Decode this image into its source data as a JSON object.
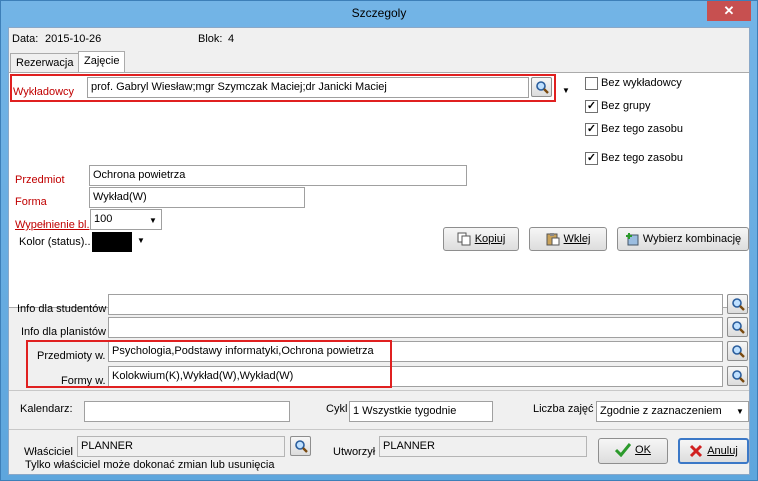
{
  "window": {
    "title": "Szczegoly",
    "close_glyph": "✕"
  },
  "header": {
    "data_label": "Data:",
    "data_value": "2015-10-26",
    "blok_label": "Blok:",
    "blok_value": "4"
  },
  "tabs": [
    {
      "label": "Rezerwacja"
    },
    {
      "label": "Zajęcie"
    }
  ],
  "zajecie": {
    "wykladowcy_label": "Wykładowcy",
    "wykladowcy_value": "prof. Gabryl Wiesław;mgr Szymczak Maciej;dr Janicki Maciej",
    "checkboxes": [
      {
        "label": "Bez wykładowcy",
        "checked": false
      },
      {
        "label": "Bez grupy",
        "checked": true
      },
      {
        "label": "Bez tego zasobu",
        "checked": true
      },
      {
        "label": "Bez tego zasobu",
        "checked": true
      }
    ],
    "przedmiot_label": "Przedmiot",
    "przedmiot_value": "Ochrona powietrza",
    "forma_label": "Forma",
    "forma_value": "Wykład(W)",
    "wypelnienie_label": "Wypełnienie bl.",
    "wypelnienie_value": "100",
    "kolor_label": "Kolor (status)..",
    "kolor_color": "#000000",
    "kopiuj_label": "Kopiuj",
    "wklej_label": "Wklej",
    "wybierz_label": "Wybierz kombinację"
  },
  "info": {
    "studentow_label": "Info dla studentów",
    "studentow_value": "",
    "planistow_label": "Info dla planistów",
    "planistow_value": "",
    "przedmioty_label": "Przedmioty w.",
    "przedmioty_value": "Psychologia,Podstawy informatyki,Ochrona powietrza",
    "formy_label": "Formy w.",
    "formy_value": "Kolokwium(K),Wykład(W),Wykład(W)"
  },
  "schedule": {
    "kalendarz_label": "Kalendarz:",
    "kalendarz_value": "",
    "cykl_label": "Cykl",
    "cykl_value": "1 Wszystkie tygodnie",
    "liczba_label": "Liczba zajęć",
    "liczba_value": "Zgodnie z zaznaczeniem"
  },
  "footer": {
    "wlasciciel_label": "Właściciel",
    "wlasciciel_value": "PLANNER",
    "note": "Tylko właściciel może dokonać zmian lub usunięcia",
    "utworzyl_label": "Utworzył",
    "utworzyl_value": "PLANNER",
    "ok_label": "OK",
    "anuluj_label": "Anuluj"
  },
  "colors": {
    "accent_red": "#c00000",
    "highlight_red": "#e02020",
    "title_blue": "#5ea6dd"
  }
}
